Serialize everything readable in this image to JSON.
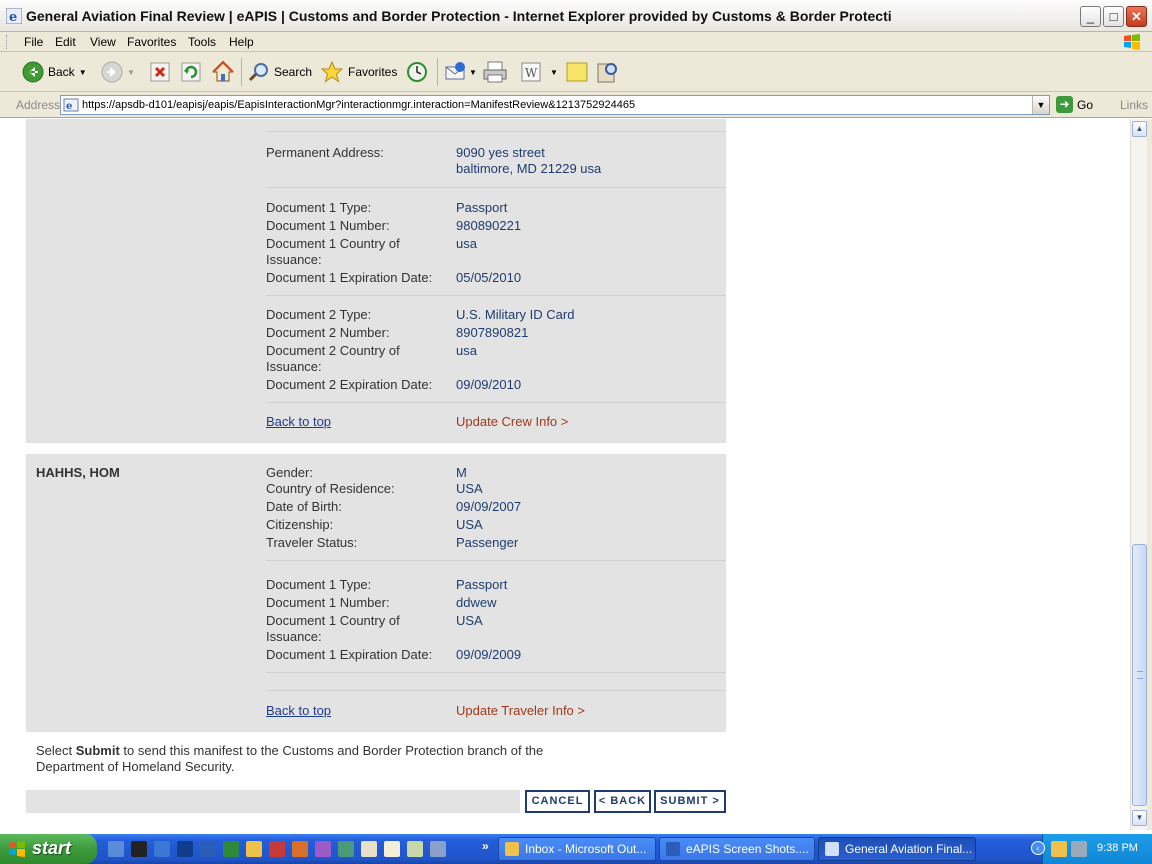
{
  "window": {
    "title": "General Aviation Final Review | eAPIS | Customs and Border Protection - Internet Explorer provided by Customs & Border Protecti"
  },
  "menu": [
    "File",
    "Edit",
    "View",
    "Favorites",
    "Tools",
    "Help"
  ],
  "toolbar": {
    "back": "Back",
    "search": "Search",
    "favorites": "Favorites"
  },
  "address": {
    "label": "Address",
    "url": "https://apsdb-d101/eapisj/eapis/EapisInteractionMgr?interactionmgr.interaction=ManifestReview&1213752924465",
    "go": "Go",
    "links": "Links"
  },
  "crew": {
    "permanent_address_label": "Permanent Address:",
    "permanent_address_line1": "9090 yes street",
    "permanent_address_line2": "baltimore, MD 21229 usa",
    "doc1": {
      "type_label": "Document 1 Type:",
      "type": "Passport",
      "number_label": "Document 1 Number:",
      "number": "980890221",
      "country_label_1": "Document 1 Country of",
      "country_label_2": "Issuance:",
      "country": "usa",
      "exp_label": "Document 1 Expiration Date:",
      "exp": "05/05/2010"
    },
    "doc2": {
      "type_label": "Document 2 Type:",
      "type": "U.S. Military ID Card",
      "number_label": "Document 2 Number:",
      "number": "8907890821",
      "country_label_1": "Document 2 Country of",
      "country_label_2": "Issuance:",
      "country": "usa",
      "exp_label": "Document 2 Expiration Date:",
      "exp": "09/09/2010"
    },
    "back_to_top": "Back to top",
    "update": "Update Crew Info >"
  },
  "traveler": {
    "name": "HAHHS, HOM",
    "gender_label": "Gender:",
    "gender": "M",
    "residence_label": "Country of Residence:",
    "residence": "USA",
    "dob_label": "Date of Birth:",
    "dob": "09/09/2007",
    "citizenship_label": "Citizenship:",
    "citizenship": "USA",
    "status_label": "Traveler Status:",
    "status": "Passenger",
    "doc1": {
      "type_label": "Document 1 Type:",
      "type": "Passport",
      "number_label": "Document 1 Number:",
      "number": "ddwew",
      "country_label_1": "Document 1 Country of",
      "country_label_2": "Issuance:",
      "country": "USA",
      "exp_label": "Document 1 Expiration Date:",
      "exp": "09/09/2009"
    },
    "back_to_top": "Back to top",
    "update": "Update Traveler Info >"
  },
  "instructions": {
    "pre": "Select ",
    "bold": "Submit",
    "post": " to send this manifest to the Customs and Border Protection branch of the",
    "line2": "Department of Homeland Security."
  },
  "buttons": {
    "cancel": "CANCEL",
    "back": "< BACK",
    "submit": "SUBMIT >"
  },
  "taskbar": {
    "start": "start",
    "tasks": [
      "Inbox - Microsoft Out...",
      "eAPIS Screen Shots....",
      "General Aviation Final..."
    ],
    "clock": "9:38 PM"
  }
}
